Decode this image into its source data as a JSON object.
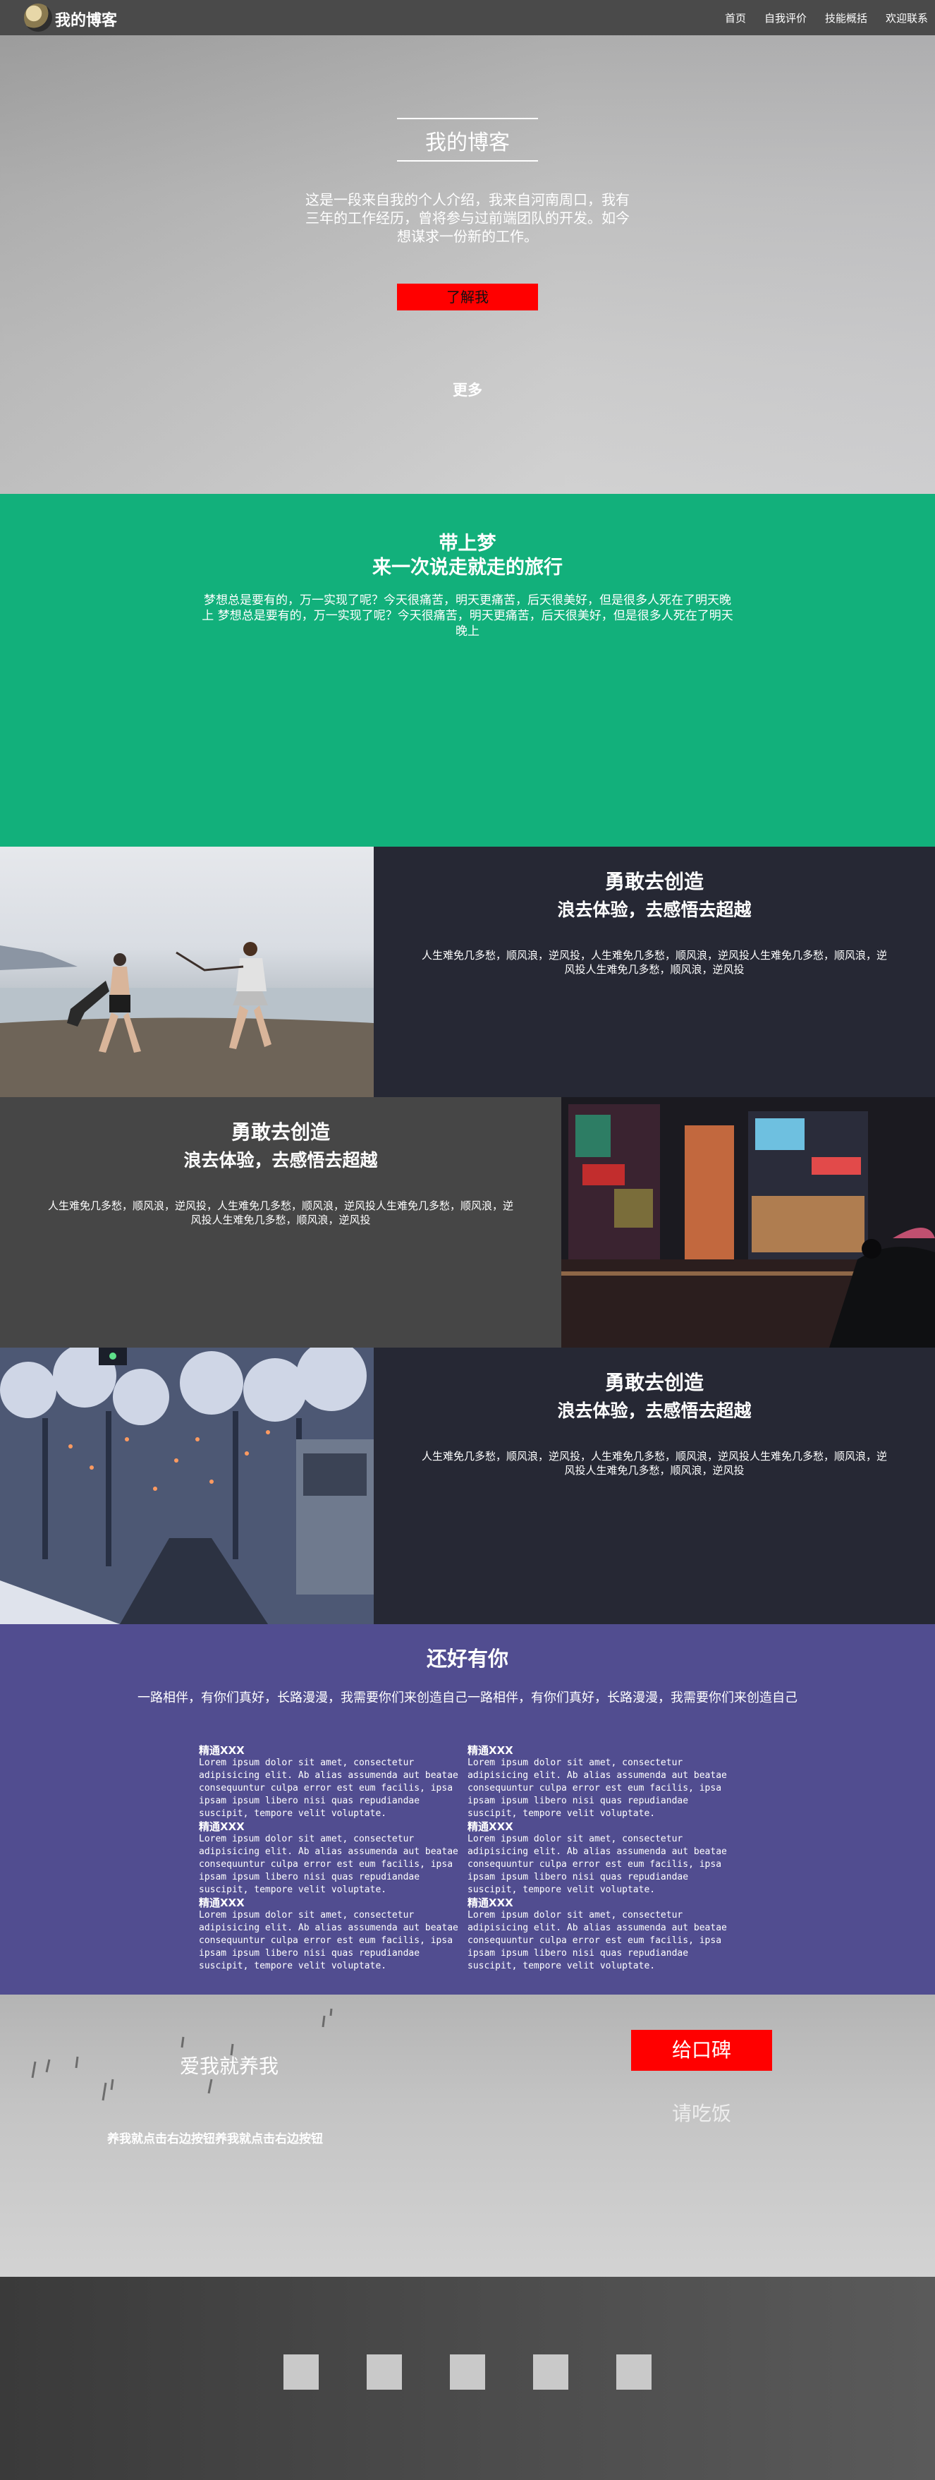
{
  "nav": {
    "brand": "我的博客",
    "links": [
      "首页",
      "自我评价",
      "技能概括",
      "欢迎联系"
    ]
  },
  "hero": {
    "title": "我的博客",
    "description": "这是一段来自我的个人介绍，我来自河南周口，我有三年的工作经历，曾将参与过前端团队的开发。如今想谋求一份新的工作。",
    "button": "了解我",
    "more": "更多"
  },
  "green": {
    "title": "带上梦",
    "subtitle": "来一次说走就走的旅行",
    "text": "梦想总是要有的，万一实现了呢？今天很痛苦，明天更痛苦，后天很美好，但是很多人死在了明天晚上 梦想总是要有的，万一实现了呢？今天很痛苦，明天更痛苦，后天很美好，但是很多人死在了明天晚上"
  },
  "features": [
    {
      "title": "勇敢去创造",
      "subtitle": "浪去体验，去感悟去超越",
      "text": "人生难免几多愁，顺风浪，逆风投，人生难免几多愁，顺风浪，逆风投人生难免几多愁，顺风浪，逆风投人生难免几多愁，顺风浪，逆风投"
    },
    {
      "title": "勇敢去创造",
      "subtitle": "浪去体验，去感悟去超越",
      "text": "人生难免几多愁，顺风浪，逆风投，人生难免几多愁，顺风浪，逆风投人生难免几多愁，顺风浪，逆风投人生难免几多愁，顺风浪，逆风投"
    },
    {
      "title": "勇敢去创造",
      "subtitle": "浪去体验，去感悟去超越",
      "text": "人生难免几多愁，顺风浪，逆风投，人生难免几多愁，顺风浪，逆风投人生难免几多愁，顺风浪，逆风投人生难免几多愁，顺风浪，逆风投"
    }
  ],
  "section4": {
    "title": "还好有你",
    "subtitle": "一路相伴，有你们真好，长路漫漫，我需要你们来创造自己一路相伴，有你们真好，长路漫漫，我需要你们来创造自己",
    "items": [
      {
        "title": "精通XXX",
        "text": "Lorem ipsum dolor sit amet, consectetur adipisicing elit. Ab alias assumenda aut beatae consequuntur culpa error est eum facilis, ipsa ipsam ipsum libero nisi quas repudiandae suscipit, tempore velit voluptate."
      },
      {
        "title": "精通XXX",
        "text": "Lorem ipsum dolor sit amet, consectetur adipisicing elit. Ab alias assumenda aut beatae consequuntur culpa error est eum facilis, ipsa ipsam ipsum libero nisi quas repudiandae suscipit, tempore velit voluptate."
      },
      {
        "title": "精通XXX",
        "text": "Lorem ipsum dolor sit amet, consectetur adipisicing elit. Ab alias assumenda aut beatae consequuntur culpa error est eum facilis, ipsa ipsam ipsum libero nisi quas repudiandae suscipit, tempore velit voluptate."
      },
      {
        "title": "精通XXX",
        "text": "Lorem ipsum dolor sit amet, consectetur adipisicing elit. Ab alias assumenda aut beatae consequuntur culpa error est eum facilis, ipsa ipsam ipsum libero nisi quas repudiandae suscipit, tempore velit voluptate."
      },
      {
        "title": "精通XXX",
        "text": "Lorem ipsum dolor sit amet, consectetur adipisicing elit. Ab alias assumenda aut beatae consequuntur culpa error est eum facilis, ipsa ipsam ipsum libero nisi quas repudiandae suscipit, tempore velit voluptate."
      },
      {
        "title": "精通XXX",
        "text": "Lorem ipsum dolor sit amet, consectetur adipisicing elit. Ab alias assumenda aut beatae consequuntur culpa error est eum facilis, ipsa ipsam ipsum libero nisi quas repudiandae suscipit, tempore velit voluptate."
      }
    ]
  },
  "cta": {
    "left_title": "爱我就养我",
    "left_text": "养我就点击右边按钮养我就点击右边按钮",
    "button1": "给口碑",
    "button2": "请吃饭"
  },
  "colors": {
    "accent_red": "#ff0000",
    "green": "#12b07b",
    "purple": "#514d90",
    "dark_panel": "#262834",
    "mid_panel": "#464646"
  }
}
